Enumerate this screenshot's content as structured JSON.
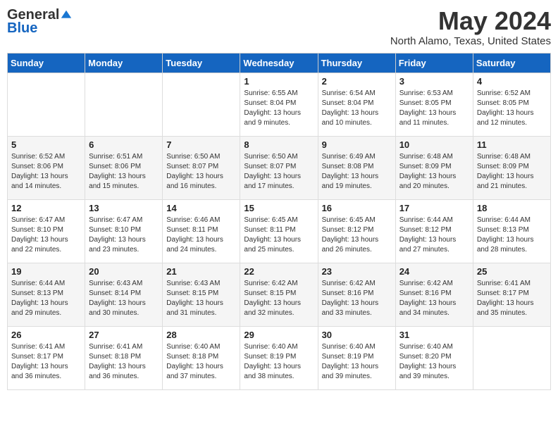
{
  "logo": {
    "general": "General",
    "blue": "Blue"
  },
  "title": "May 2024",
  "location": "North Alamo, Texas, United States",
  "days_of_week": [
    "Sunday",
    "Monday",
    "Tuesday",
    "Wednesday",
    "Thursday",
    "Friday",
    "Saturday"
  ],
  "weeks": [
    [
      {
        "day": "",
        "info": ""
      },
      {
        "day": "",
        "info": ""
      },
      {
        "day": "",
        "info": ""
      },
      {
        "day": "1",
        "info": "Sunrise: 6:55 AM\nSunset: 8:04 PM\nDaylight: 13 hours\nand 9 minutes."
      },
      {
        "day": "2",
        "info": "Sunrise: 6:54 AM\nSunset: 8:04 PM\nDaylight: 13 hours\nand 10 minutes."
      },
      {
        "day": "3",
        "info": "Sunrise: 6:53 AM\nSunset: 8:05 PM\nDaylight: 13 hours\nand 11 minutes."
      },
      {
        "day": "4",
        "info": "Sunrise: 6:52 AM\nSunset: 8:05 PM\nDaylight: 13 hours\nand 12 minutes."
      }
    ],
    [
      {
        "day": "5",
        "info": "Sunrise: 6:52 AM\nSunset: 8:06 PM\nDaylight: 13 hours\nand 14 minutes."
      },
      {
        "day": "6",
        "info": "Sunrise: 6:51 AM\nSunset: 8:06 PM\nDaylight: 13 hours\nand 15 minutes."
      },
      {
        "day": "7",
        "info": "Sunrise: 6:50 AM\nSunset: 8:07 PM\nDaylight: 13 hours\nand 16 minutes."
      },
      {
        "day": "8",
        "info": "Sunrise: 6:50 AM\nSunset: 8:07 PM\nDaylight: 13 hours\nand 17 minutes."
      },
      {
        "day": "9",
        "info": "Sunrise: 6:49 AM\nSunset: 8:08 PM\nDaylight: 13 hours\nand 19 minutes."
      },
      {
        "day": "10",
        "info": "Sunrise: 6:48 AM\nSunset: 8:09 PM\nDaylight: 13 hours\nand 20 minutes."
      },
      {
        "day": "11",
        "info": "Sunrise: 6:48 AM\nSunset: 8:09 PM\nDaylight: 13 hours\nand 21 minutes."
      }
    ],
    [
      {
        "day": "12",
        "info": "Sunrise: 6:47 AM\nSunset: 8:10 PM\nDaylight: 13 hours\nand 22 minutes."
      },
      {
        "day": "13",
        "info": "Sunrise: 6:47 AM\nSunset: 8:10 PM\nDaylight: 13 hours\nand 23 minutes."
      },
      {
        "day": "14",
        "info": "Sunrise: 6:46 AM\nSunset: 8:11 PM\nDaylight: 13 hours\nand 24 minutes."
      },
      {
        "day": "15",
        "info": "Sunrise: 6:45 AM\nSunset: 8:11 PM\nDaylight: 13 hours\nand 25 minutes."
      },
      {
        "day": "16",
        "info": "Sunrise: 6:45 AM\nSunset: 8:12 PM\nDaylight: 13 hours\nand 26 minutes."
      },
      {
        "day": "17",
        "info": "Sunrise: 6:44 AM\nSunset: 8:12 PM\nDaylight: 13 hours\nand 27 minutes."
      },
      {
        "day": "18",
        "info": "Sunrise: 6:44 AM\nSunset: 8:13 PM\nDaylight: 13 hours\nand 28 minutes."
      }
    ],
    [
      {
        "day": "19",
        "info": "Sunrise: 6:44 AM\nSunset: 8:13 PM\nDaylight: 13 hours\nand 29 minutes."
      },
      {
        "day": "20",
        "info": "Sunrise: 6:43 AM\nSunset: 8:14 PM\nDaylight: 13 hours\nand 30 minutes."
      },
      {
        "day": "21",
        "info": "Sunrise: 6:43 AM\nSunset: 8:15 PM\nDaylight: 13 hours\nand 31 minutes."
      },
      {
        "day": "22",
        "info": "Sunrise: 6:42 AM\nSunset: 8:15 PM\nDaylight: 13 hours\nand 32 minutes."
      },
      {
        "day": "23",
        "info": "Sunrise: 6:42 AM\nSunset: 8:16 PM\nDaylight: 13 hours\nand 33 minutes."
      },
      {
        "day": "24",
        "info": "Sunrise: 6:42 AM\nSunset: 8:16 PM\nDaylight: 13 hours\nand 34 minutes."
      },
      {
        "day": "25",
        "info": "Sunrise: 6:41 AM\nSunset: 8:17 PM\nDaylight: 13 hours\nand 35 minutes."
      }
    ],
    [
      {
        "day": "26",
        "info": "Sunrise: 6:41 AM\nSunset: 8:17 PM\nDaylight: 13 hours\nand 36 minutes."
      },
      {
        "day": "27",
        "info": "Sunrise: 6:41 AM\nSunset: 8:18 PM\nDaylight: 13 hours\nand 36 minutes."
      },
      {
        "day": "28",
        "info": "Sunrise: 6:40 AM\nSunset: 8:18 PM\nDaylight: 13 hours\nand 37 minutes."
      },
      {
        "day": "29",
        "info": "Sunrise: 6:40 AM\nSunset: 8:19 PM\nDaylight: 13 hours\nand 38 minutes."
      },
      {
        "day": "30",
        "info": "Sunrise: 6:40 AM\nSunset: 8:19 PM\nDaylight: 13 hours\nand 39 minutes."
      },
      {
        "day": "31",
        "info": "Sunrise: 6:40 AM\nSunset: 8:20 PM\nDaylight: 13 hours\nand 39 minutes."
      },
      {
        "day": "",
        "info": ""
      }
    ]
  ]
}
